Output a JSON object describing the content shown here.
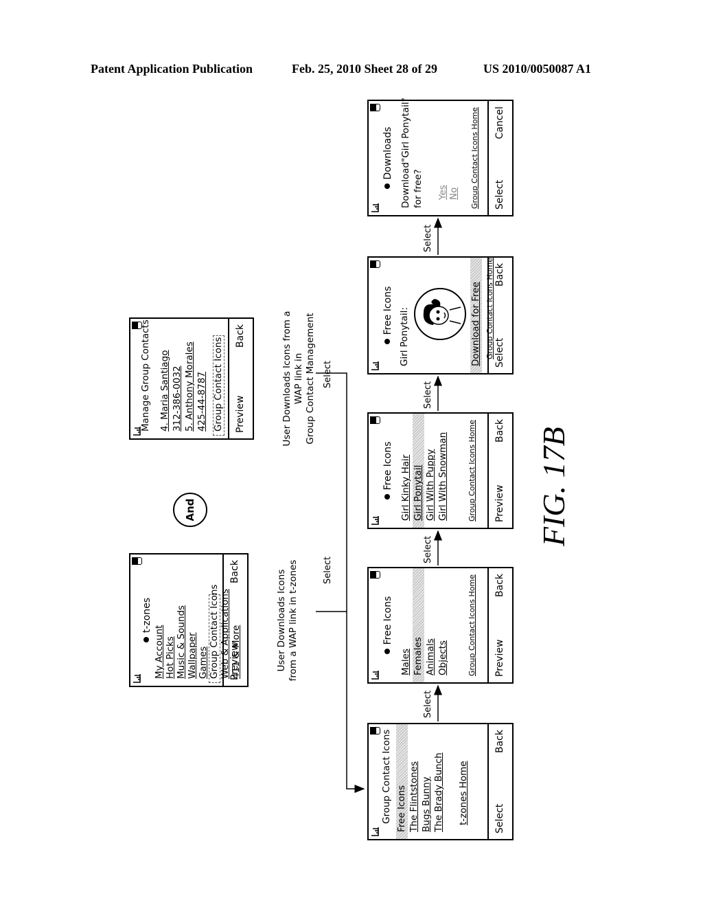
{
  "header": {
    "publication": "Patent Application Publication",
    "date_sheet": "Feb. 25, 2010   Sheet 28 of 29",
    "number": "US 2010/0050087 A1"
  },
  "figure_label": "FIG. 17B",
  "and_label": "And",
  "screens": {
    "tzones": {
      "title": "t-zones",
      "items": [
        "My Account",
        "Hot Picks",
        "Music & Sounds",
        "Wallpaper",
        "Games",
        "Group Contact Icons",
        "Web & Applications",
        "411 & More"
      ],
      "left_key": "Preview",
      "right_key": "Back",
      "caption_line1": "User Downloads Icons",
      "caption_line2": "from a WAP link in t-zones"
    },
    "manage": {
      "title": "Manage Group Contacts",
      "items": [
        "4. Maria Santiago",
        "312-386-0032",
        "5. Anthony Morales",
        "425-44-8787",
        "Group Contact Icons"
      ],
      "left_key": "Preview",
      "right_key": "Back",
      "caption_line1": "User Downloads Icons from a",
      "caption_line2": "WAP link in",
      "caption_line3": "Group Contact Management"
    },
    "gci": {
      "title": "Group Contact Icons",
      "items": [
        "Free Icons",
        "The Flintstones",
        "Bugs Bunny",
        "The Brady Bunch",
        "t-zones Home"
      ],
      "left_key": "Select",
      "right_key": "Back"
    },
    "free1": {
      "title": "Free Icons",
      "items": [
        "Males",
        "Females",
        "Animals",
        "Objects"
      ],
      "home_link": "Group Contact Icons Home",
      "left_key": "Preview",
      "right_key": "Back"
    },
    "free2": {
      "title": "Free Icons",
      "items": [
        "Girl Kinky Hair",
        "Girl Ponytail",
        "Girl With Puppy",
        "Girl With Snowman"
      ],
      "home_link": "Group Contact Icons Home",
      "left_key": "Preview",
      "right_key": "Back"
    },
    "ponytail": {
      "title": "Free Icons",
      "subtitle": "Girl Ponytail:",
      "action": "Download for Free",
      "home_link": "Group Contact Icons Home",
      "left_key": "Select",
      "right_key": "Back"
    },
    "downloads": {
      "title": "Downloads",
      "prompt_line1": "Download\"Girl Ponytail\"",
      "prompt_line2": "for free?",
      "options": [
        "Yes",
        "No"
      ],
      "home_link": "Group Contact Icons Home",
      "left_key": "Select",
      "right_key": "Cancel"
    }
  },
  "transitions": {
    "select": "Select"
  }
}
